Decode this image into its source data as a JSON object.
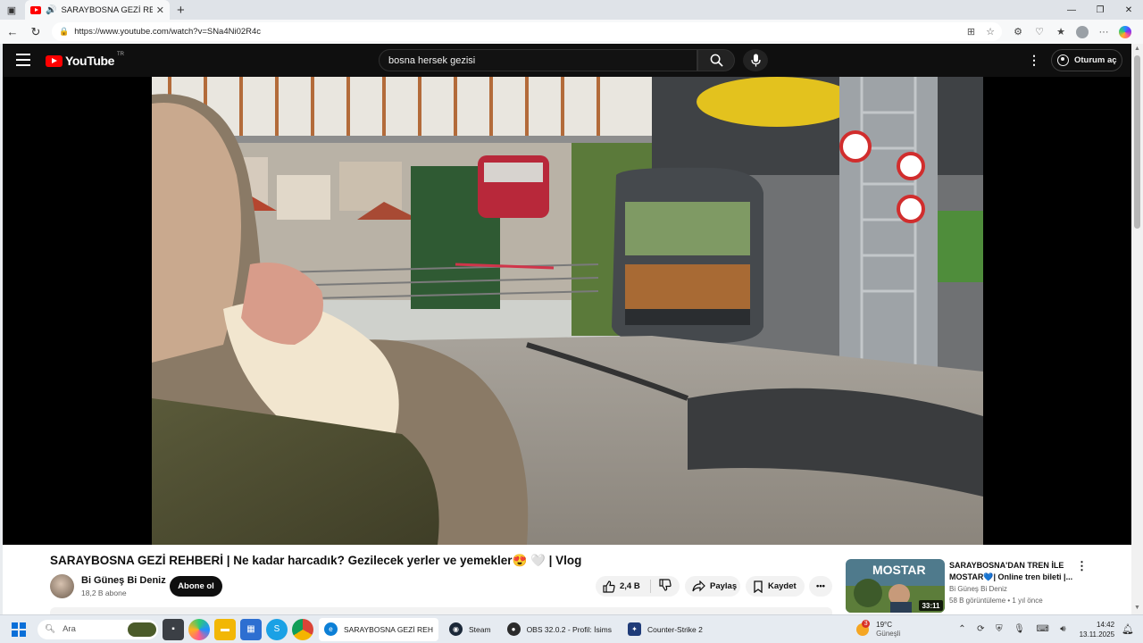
{
  "browser": {
    "tab_title": "SARAYBOSNA GEZİ REHBERİ",
    "url": "https://www.youtube.com/watch?v=SNa4Ni02R4c"
  },
  "youtube": {
    "logo_text": "YouTube",
    "country_code": "TR",
    "search_value": "bosna hersek gezisi",
    "signin_label": "Oturum aç"
  },
  "video": {
    "title": "SARAYBOSNA GEZİ REHBERİ | Ne kadar harcadık? Gezilecek yerler ve yemekler😍 🤍 | Vlog",
    "channel": "Bi Güneş Bi Deniz",
    "subscribers": "18,2 B abone",
    "subscribe_label": "Abone ol",
    "likes": "2,4 B",
    "share_label": "Paylaş",
    "save_label": "Kaydet"
  },
  "recommendation": {
    "title": "SARAYBOSNA'DAN TREN İLE MOSTAR💙| Online tren bileti |...",
    "channel": "Bi Güneş Bi Deniz",
    "meta": "58 B görüntüleme • 1 yıl önce",
    "duration": "33:11",
    "thumb_text": "MOSTAR"
  },
  "taskbar": {
    "search_placeholder": "Ara",
    "apps": [
      {
        "label": "SARAYBOSNA GEZİ REH",
        "color": "#0c7fd6"
      },
      {
        "label": "Steam",
        "color": "#1b2838"
      },
      {
        "label": "OBS 32.0.2 - Profil: İsims",
        "color": "#2b2b2b"
      },
      {
        "label": "Counter-Strike 2",
        "color": "#1f3b78"
      }
    ],
    "weather_temp": "19°C",
    "weather_desc": "Güneşli",
    "weather_badge": "3",
    "time": "14:42",
    "date": "13.11.2025"
  },
  "colors": {
    "yt_red": "#ff0000",
    "masthead_bg": "#0f0f0f"
  }
}
